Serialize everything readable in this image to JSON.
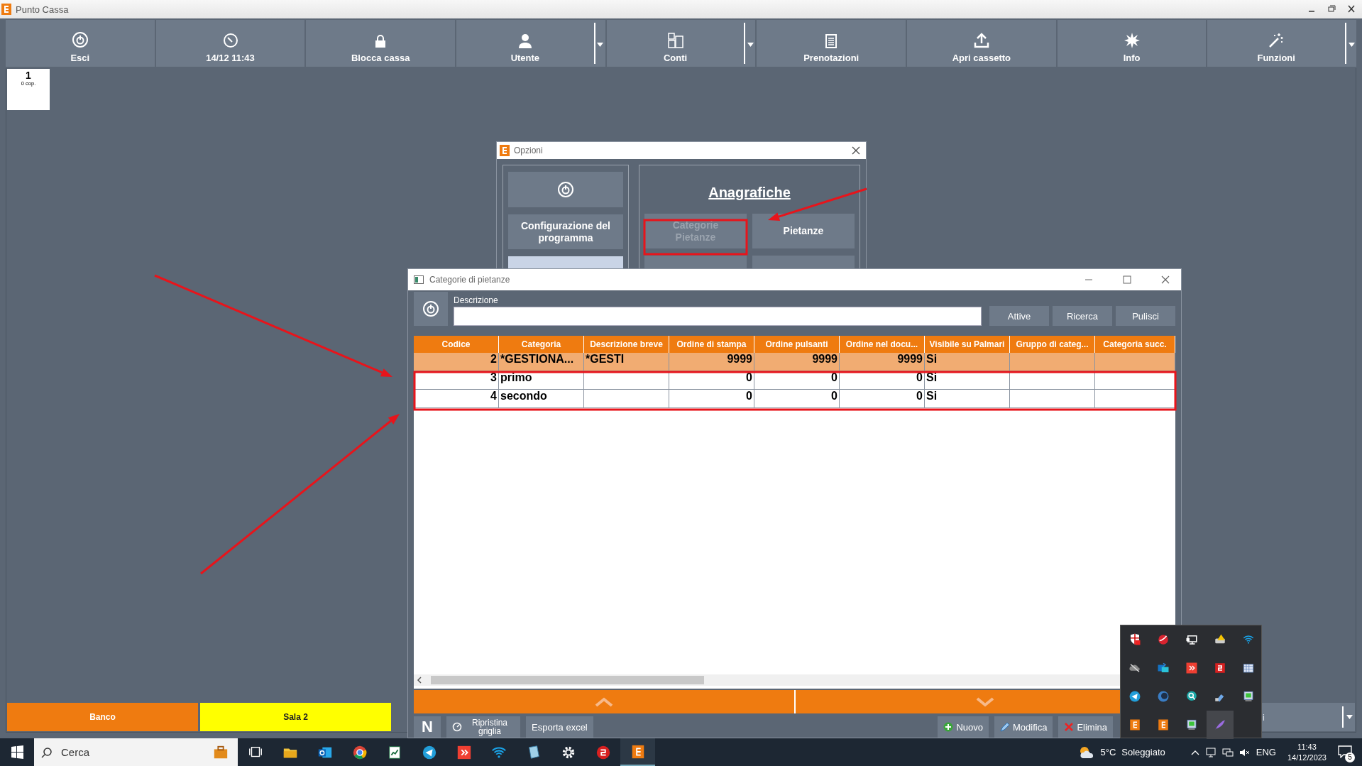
{
  "app_window": {
    "title": "Punto Cassa"
  },
  "toolbar": [
    {
      "label": "Esci",
      "has_menu": false
    },
    {
      "label": "14/12 11:43",
      "has_menu": false
    },
    {
      "label": "Blocca cassa",
      "has_menu": false
    },
    {
      "label": "Utente",
      "has_menu": true
    },
    {
      "label": "Conti",
      "has_menu": true
    },
    {
      "label": "Prenotazioni",
      "has_menu": false
    },
    {
      "label": "Apri cassetto",
      "has_menu": false
    },
    {
      "label": "Info",
      "has_menu": false
    },
    {
      "label": "Funzioni",
      "has_menu": true
    }
  ],
  "tables": [
    {
      "number": "1",
      "covers": "0 cop."
    }
  ],
  "rooms": [
    {
      "label": "Banco",
      "selected": false
    },
    {
      "label": "Sala 2",
      "selected": true
    }
  ],
  "room_selector": {
    "text": "i"
  },
  "options_dialog": {
    "title": "Opzioni",
    "program_button": "Configurazione del programma",
    "section_title": "Anagrafiche",
    "buttons": [
      {
        "label": "Categorie Pietanze",
        "disabled": true
      },
      {
        "label": "Pietanze",
        "disabled": false
      }
    ]
  },
  "categories_window": {
    "title": "Categorie di pietanze",
    "search": {
      "label": "Descrizione"
    },
    "buttons": [
      "Attive",
      "Ricerca",
      "Pulisci"
    ],
    "table": {
      "columns": [
        {
          "label": "Codice"
        },
        {
          "label": "Categoria"
        },
        {
          "label": "Descrizione breve"
        },
        {
          "label": "Ordine di stampa"
        },
        {
          "label": "Ordine pulsanti"
        },
        {
          "label": "Ordine nel docu..."
        },
        {
          "label": "Visibile su Palmari"
        },
        {
          "label": "Gruppo di categ..."
        },
        {
          "label": "Categoria succ."
        }
      ],
      "rows": [
        {
          "selected": true,
          "cells": [
            "2",
            "*GESTIONA...",
            "*GESTI",
            "9999",
            "9999",
            "9999",
            "Si",
            "",
            ""
          ]
        },
        {
          "selected": false,
          "cells": [
            "3",
            "primo",
            "",
            "0",
            "0",
            "0",
            "Si",
            "",
            ""
          ]
        },
        {
          "selected": false,
          "cells": [
            "4",
            "secondo",
            "",
            "0",
            "0",
            "0",
            "Si",
            "",
            ""
          ]
        }
      ]
    },
    "footer_left": [
      "N",
      "Ripristina griglia",
      "Esporta excel"
    ],
    "footer_right": [
      "Nuovo",
      "Modifica",
      "Elimina"
    ]
  },
  "taskbar": {
    "search_placeholder": "Cerca",
    "temperature": "5°C",
    "weather": "Soleggiato",
    "language": "ENG",
    "time": "11:43",
    "date": "14/12/2023",
    "notifications": "5"
  }
}
